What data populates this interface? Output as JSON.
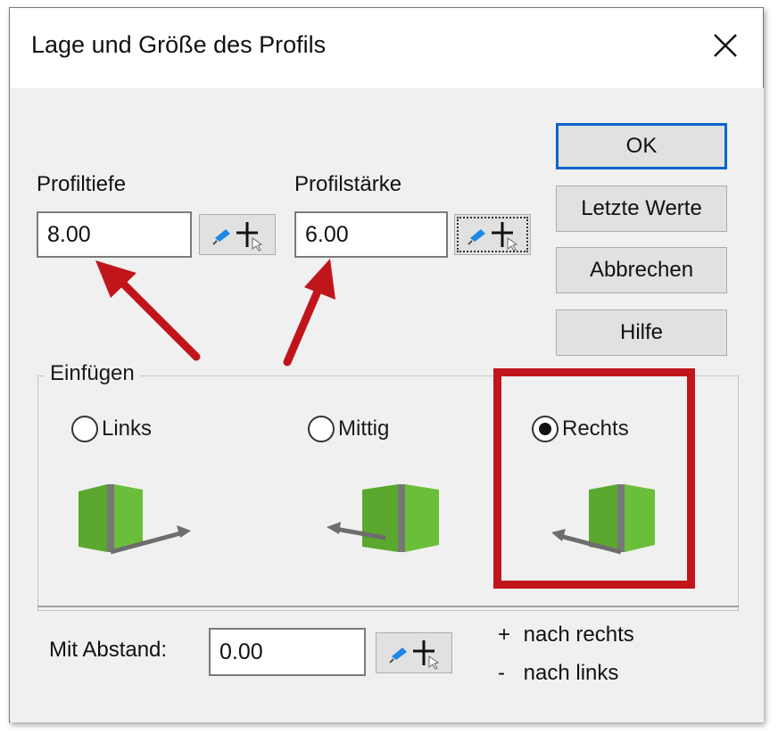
{
  "window": {
    "title": "Lage und Größe des Profils"
  },
  "fields": {
    "profiltiefe": {
      "label": "Profiltiefe",
      "value": "8.00"
    },
    "profilstaerke": {
      "label": "Profilstärke",
      "value": "6.00"
    },
    "abstand": {
      "label": "Mit Abstand:",
      "value": "0.00"
    }
  },
  "buttons": {
    "ok": "OK",
    "letzte_werte": "Letzte Werte",
    "abbrechen": "Abbrechen",
    "hilfe": "Hilfe"
  },
  "insert_group": {
    "title": "Einfügen",
    "options": [
      {
        "label": "Links",
        "selected": false
      },
      {
        "label": "Mittig",
        "selected": false
      },
      {
        "label": "Rechts",
        "selected": true
      }
    ]
  },
  "hints": {
    "plus": "+",
    "plus_text": "nach rechts",
    "minus": "-",
    "minus_text": "nach links"
  },
  "colors": {
    "annotation_red": "#c0161b",
    "profile_green": "#6abf3a",
    "default_button_border": "#0a64c8"
  },
  "icons": [
    "close-icon",
    "pick-cursor-icon",
    "profile-links-icon",
    "profile-mittig-icon",
    "profile-rechts-icon"
  ]
}
